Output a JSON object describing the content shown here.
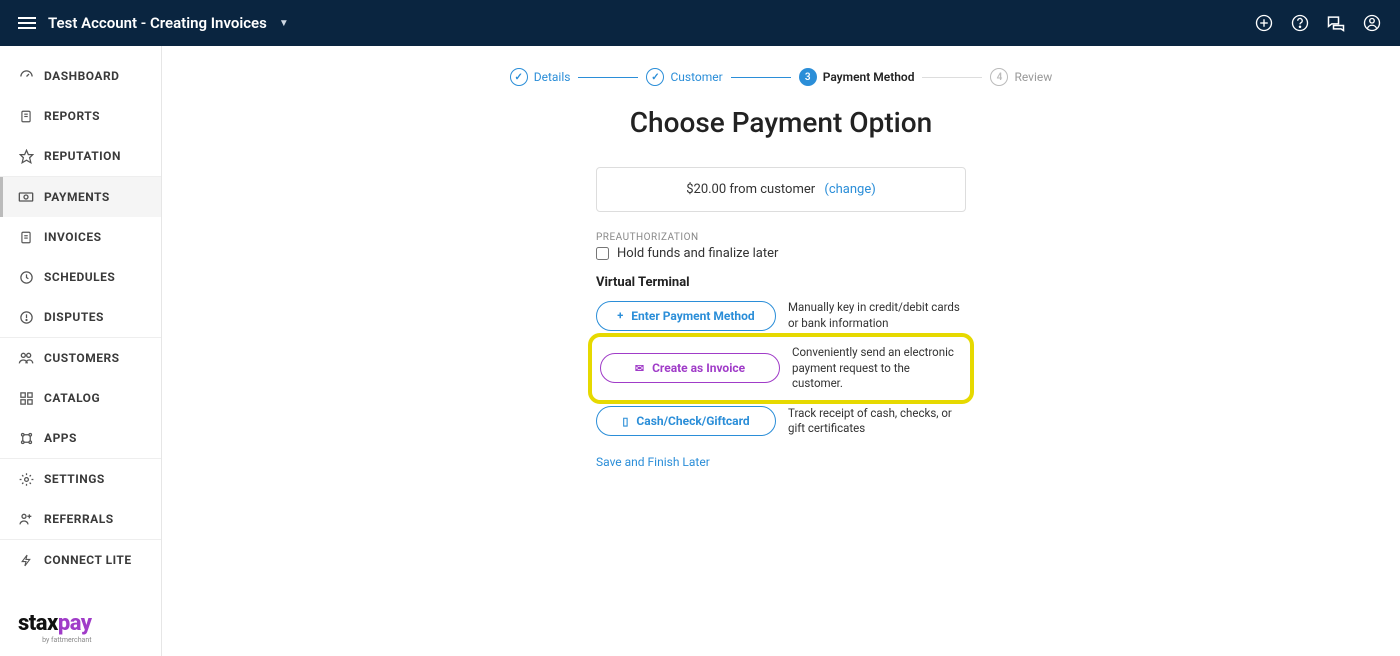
{
  "header": {
    "account_title": "Test Account - Creating Invoices"
  },
  "sidebar": {
    "items": [
      {
        "label": "DASHBOARD",
        "icon": "gauge-icon"
      },
      {
        "label": "REPORTS",
        "icon": "document-icon"
      },
      {
        "label": "REPUTATION",
        "icon": "star-icon"
      },
      {
        "label": "PAYMENTS",
        "icon": "cash-icon",
        "active": true
      },
      {
        "label": "INVOICES",
        "icon": "invoice-icon"
      },
      {
        "label": "SCHEDULES",
        "icon": "clock-icon"
      },
      {
        "label": "DISPUTES",
        "icon": "alert-icon"
      },
      {
        "label": "CUSTOMERS",
        "icon": "people-icon"
      },
      {
        "label": "CATALOG",
        "icon": "grid-icon"
      },
      {
        "label": "APPS",
        "icon": "apps-icon"
      },
      {
        "label": "SETTINGS",
        "icon": "gear-icon"
      },
      {
        "label": "REFERRALS",
        "icon": "referral-icon"
      },
      {
        "label": "CONNECT LITE",
        "icon": "bolt-icon"
      }
    ],
    "brand": {
      "left": "stax",
      "right": "pay",
      "sub": "by fattmerchant"
    }
  },
  "stepper": [
    {
      "num": "✓",
      "label": "Details",
      "state": "done"
    },
    {
      "num": "✓",
      "label": "Customer",
      "state": "done"
    },
    {
      "num": "3",
      "label": "Payment Method",
      "state": "current"
    },
    {
      "num": "4",
      "label": "Review",
      "state": "pending"
    }
  ],
  "page": {
    "title": "Choose Payment Option",
    "amount_text": "$20.00 from customer",
    "change": "(change)",
    "preauth_heading": "PREAUTHORIZATION",
    "preauth_checkbox": "Hold funds and finalize later",
    "vt_heading": "Virtual Terminal",
    "options": [
      {
        "icon": "+",
        "label": "Enter Payment Method",
        "desc": "Manually key in credit/debit cards or bank information"
      },
      {
        "icon": "✉",
        "label": "Create as Invoice",
        "desc": "Conveniently send an electronic payment request to the customer.",
        "highlight": true
      },
      {
        "icon": "▯",
        "label": "Cash/Check/Giftcard",
        "desc": "Track receipt of cash, checks, or gift certificates"
      }
    ],
    "save_link": "Save and Finish Later"
  }
}
